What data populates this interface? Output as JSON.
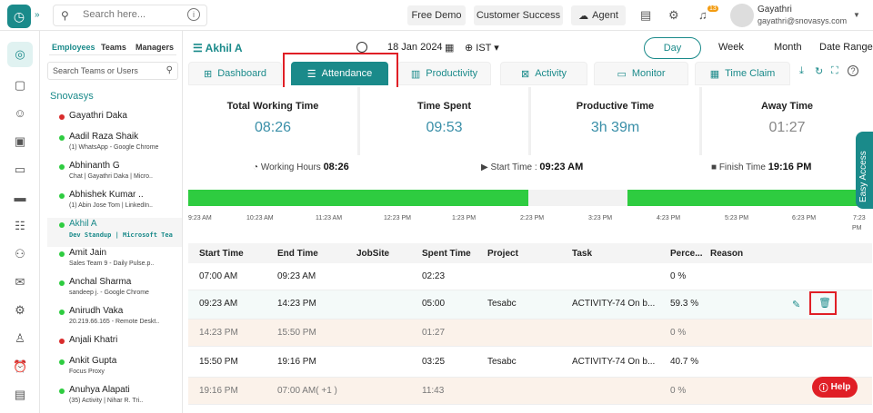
{
  "header": {
    "search_placeholder": "Search here...",
    "buttons": [
      "Free Demo",
      "Customer Success",
      "Agent"
    ],
    "notification_count": "13",
    "user_name": "Gayathri",
    "user_email": "gayathri@snovasys.com"
  },
  "users_panel": {
    "tabs": [
      "Employees",
      "Teams",
      "Managers"
    ],
    "search_placeholder": "Search Teams or Users",
    "org": "Snovasys",
    "users": [
      {
        "name": "Gayathri Daka",
        "activity": "",
        "status": "offline"
      },
      {
        "name": "Aadil Raza Shaik",
        "activity": "(1) WhatsApp - Google Chrome",
        "status": "online"
      },
      {
        "name": "Abhinanth G",
        "activity": "Chat | Gayathri Daka | Micro..",
        "status": "online"
      },
      {
        "name": "Abhishek Kumar ..",
        "activity": "(1) Abin Jose Tom | LinkedIn..",
        "status": "online"
      },
      {
        "name": "Akhil A",
        "activity": "Dev Standup | Microsoft Tea",
        "status": "online",
        "selected": true
      },
      {
        "name": "Amit Jain",
        "activity": "Sales Team 9 - Daily Pulse.p..",
        "status": "online"
      },
      {
        "name": "Anchal Sharma",
        "activity": "sandeep j. - Google Chrome",
        "status": "online"
      },
      {
        "name": "Anirudh Vaka",
        "activity": "20.219.66.165 - Remote Deskt..",
        "status": "online"
      },
      {
        "name": "Anjali Khatri",
        "activity": "",
        "status": "offline"
      },
      {
        "name": "Ankit Gupta",
        "activity": "Focus Proxy",
        "status": "online"
      },
      {
        "name": "Anuhya Alapati",
        "activity": "(35) Activity | Nihar R. Tri..",
        "status": "online"
      }
    ]
  },
  "main": {
    "user_title": "Akhil A",
    "date": "18 Jan 2024",
    "timezone": "IST",
    "ranges": [
      "Day",
      "Week",
      "Month",
      "Date Range"
    ],
    "tabs": [
      "Dashboard",
      "Attendance",
      "Productivity",
      "Activity",
      "Monitor",
      "Time Claim"
    ],
    "active_tab": "Attendance",
    "stats": [
      {
        "label": "Total Working Time",
        "value": "08:26"
      },
      {
        "label": "Time Spent",
        "value": "09:53"
      },
      {
        "label": "Productive Time",
        "value": "3h 39m"
      },
      {
        "label": "Away Time",
        "value": "01:27"
      }
    ],
    "summary": {
      "working_hours_label": "Working Hours",
      "working_hours": "08:26",
      "start_time_label": "Start Time :",
      "start_time": "09:23 AM",
      "finish_time_label": "Finish Time",
      "finish_time": "19:16 PM"
    },
    "timeline": {
      "ticks": [
        "9:23 AM",
        "10:23 AM",
        "11:23 AM",
        "12:23 PM",
        "1:23 PM",
        "2:23 PM",
        "3:23 PM",
        "4:23 PM",
        "5:23 PM",
        "6:23 PM",
        "7:23"
      ],
      "tick_last_line2": "PM",
      "active_segments": [
        {
          "start": "09:23 AM",
          "end": "14:23 PM"
        },
        {
          "start": "15:50 PM",
          "end": "19:16 PM"
        }
      ]
    },
    "table": {
      "columns": [
        "Start Time",
        "End Time",
        "JobSite",
        "Spent Time",
        "Project",
        "Task",
        "Perce...",
        "Reason"
      ],
      "rows": [
        {
          "start": "07:00 AM",
          "end": "09:23 AM",
          "jobsite": "",
          "spent": "02:23",
          "project": "",
          "task": "",
          "percent": "0 %",
          "reason": "",
          "type": "normal"
        },
        {
          "start": "09:23 AM",
          "end": "14:23 PM",
          "jobsite": "",
          "spent": "05:00",
          "project": "Tesabc",
          "task": "ACTIVITY-74 On b...",
          "percent": "59.3 %",
          "reason": "",
          "type": "highlight"
        },
        {
          "start": "14:23 PM",
          "end": "15:50 PM",
          "jobsite": "",
          "spent": "01:27",
          "project": "",
          "task": "",
          "percent": "0 %",
          "reason": "",
          "type": "idle"
        },
        {
          "start": "15:50 PM",
          "end": "19:16 PM",
          "jobsite": "",
          "spent": "03:25",
          "project": "Tesabc",
          "task": "ACTIVITY-74 On b...",
          "percent": "40.7 %",
          "reason": "",
          "type": "normal"
        },
        {
          "start": "19:16 PM",
          "end": "07:00 AM( +1 )",
          "jobsite": "",
          "spent": "11:43",
          "project": "",
          "task": "",
          "percent": "0 %",
          "reason": "",
          "type": "idle"
        }
      ]
    }
  },
  "easy_access": "Easy Access",
  "help": "Help",
  "colors": {
    "brand": "#1a8a8a",
    "active_bar": "#2ecc40",
    "highlight_border": "#e01f26"
  }
}
